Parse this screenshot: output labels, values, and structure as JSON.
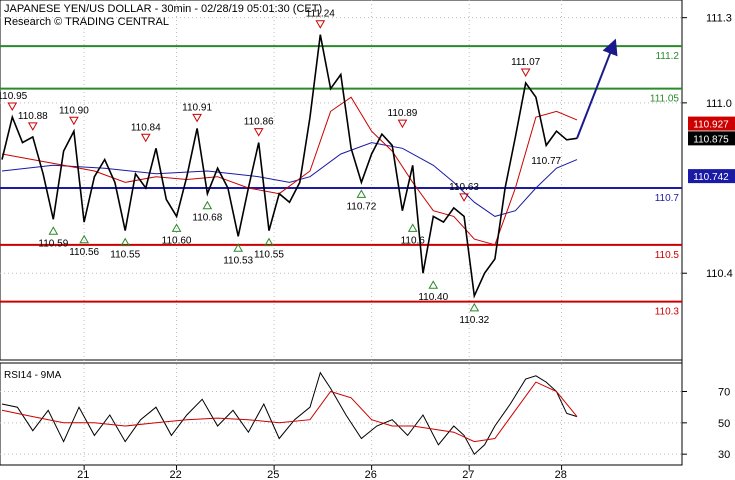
{
  "header": {
    "title": "JAPANESE YEN/US DOLLAR - 30min - 02/28/19 05:01:30 (CET)",
    "subtitle": "Research © TRADING CENTRAL"
  },
  "colors": {
    "price": "#000000",
    "ma_fast": "#cc0000",
    "ma_slow": "#1a1aa6",
    "resistance": "#2a8a2a",
    "support": "#cc0000",
    "pivot": "#1a1aa6",
    "up_marker": "#2a8a2a",
    "down_marker": "#cc0000",
    "arrow": "#1a1a8c"
  },
  "chart_data": [
    {
      "type": "line",
      "panel": "price",
      "x_ticks": [
        "21",
        "22",
        "25",
        "26",
        "27",
        "28"
      ],
      "y_ticks": [
        "111.3",
        "111.0",
        "110.4"
      ],
      "ylim": [
        110.2,
        111.32
      ],
      "series": [
        {
          "name": "price",
          "x": [
            0,
            2,
            4,
            6,
            8,
            10,
            12,
            14,
            16,
            18,
            20,
            22,
            24,
            26,
            28,
            30,
            32,
            34,
            36,
            38,
            40,
            42,
            44,
            46,
            48,
            50,
            52,
            54,
            56,
            58,
            60,
            62,
            64,
            66,
            68,
            70,
            72,
            74,
            76,
            78,
            80,
            82,
            84,
            86,
            88,
            90,
            92,
            94,
            96,
            98,
            100,
            102,
            104,
            106,
            108,
            110,
            112
          ],
          "values": [
            110.8,
            110.95,
            110.86,
            110.88,
            110.75,
            110.59,
            110.83,
            110.9,
            110.58,
            110.74,
            110.8,
            110.72,
            110.55,
            110.75,
            110.7,
            110.84,
            110.66,
            110.6,
            110.74,
            110.91,
            110.68,
            110.77,
            110.7,
            110.53,
            110.7,
            110.86,
            110.55,
            110.68,
            110.65,
            110.72,
            110.95,
            111.24,
            111.05,
            111.1,
            110.84,
            110.72,
            110.82,
            110.89,
            110.85,
            110.62,
            110.78,
            110.4,
            110.6,
            110.58,
            110.63,
            110.6,
            110.32,
            110.4,
            110.45,
            110.7,
            110.88,
            111.07,
            111.02,
            110.85,
            110.9,
            110.87,
            110.875
          ]
        },
        {
          "name": "fast_ma",
          "x": [
            0,
            6,
            12,
            18,
            24,
            30,
            36,
            42,
            48,
            54,
            60,
            64,
            68,
            72,
            76,
            80,
            84,
            88,
            92,
            96,
            100,
            104,
            108,
            112
          ],
          "values": [
            110.82,
            110.8,
            110.78,
            110.76,
            110.72,
            110.74,
            110.73,
            110.74,
            110.7,
            110.68,
            110.76,
            110.97,
            111.02,
            110.9,
            110.83,
            110.72,
            110.62,
            110.6,
            110.52,
            110.5,
            110.7,
            110.95,
            110.97,
            110.94
          ]
        },
        {
          "name": "slow_ma",
          "x": [
            0,
            10,
            20,
            30,
            40,
            50,
            56,
            60,
            66,
            72,
            78,
            84,
            88,
            92,
            96,
            100,
            104,
            108,
            112
          ],
          "values": [
            110.76,
            110.78,
            110.77,
            110.75,
            110.76,
            110.74,
            110.72,
            110.74,
            110.82,
            110.86,
            110.84,
            110.78,
            110.72,
            110.65,
            110.6,
            110.62,
            110.7,
            110.77,
            110.8
          ]
        }
      ],
      "forecast_arrow": {
        "x": [
          112,
          119
        ],
        "values": [
          110.875,
          111.2
        ]
      },
      "levels": [
        {
          "value": 111.2,
          "label": "111.2",
          "kind": "resistance"
        },
        {
          "value": 111.05,
          "label": "111.05",
          "kind": "resistance"
        },
        {
          "value": 110.7,
          "label": "110.7",
          "kind": "pivot"
        },
        {
          "value": 110.5,
          "label": "110.5",
          "kind": "support"
        },
        {
          "value": 110.3,
          "label": "110.3",
          "kind": "support"
        }
      ],
      "current_values": [
        {
          "value": 110.927,
          "label": "110.927",
          "bg": "#cc0000",
          "fg": "#ffffff"
        },
        {
          "value": 110.875,
          "label": "110.875",
          "bg": "#000000",
          "fg": "#ffffff"
        },
        {
          "value": 110.742,
          "label": "110.742",
          "bg": "#1a1aa6",
          "fg": "#ffffff"
        }
      ],
      "annotations": [
        {
          "x": 2,
          "value": 110.95,
          "text": "110.95",
          "dir": "down"
        },
        {
          "x": 6,
          "value": 110.88,
          "text": "110.88",
          "dir": "down"
        },
        {
          "x": 10,
          "value": 110.59,
          "text": "110.59",
          "dir": "up"
        },
        {
          "x": 14,
          "value": 110.9,
          "text": "110.90",
          "dir": "down"
        },
        {
          "x": 16,
          "value": 110.56,
          "text": "110.56",
          "dir": "up"
        },
        {
          "x": 24,
          "value": 110.55,
          "text": "110.55",
          "dir": "up"
        },
        {
          "x": 28,
          "value": 110.84,
          "text": "110.84",
          "dir": "down"
        },
        {
          "x": 34,
          "value": 110.6,
          "text": "110.60",
          "dir": "up"
        },
        {
          "x": 38,
          "value": 110.91,
          "text": "110.91",
          "dir": "down"
        },
        {
          "x": 40,
          "value": 110.68,
          "text": "110.68",
          "dir": "up"
        },
        {
          "x": 46,
          "value": 110.53,
          "text": "110.53",
          "dir": "up"
        },
        {
          "x": 50,
          "value": 110.86,
          "text": "110.86",
          "dir": "down"
        },
        {
          "x": 52,
          "value": 110.55,
          "text": "110.55",
          "dir": "up"
        },
        {
          "x": 62,
          "value": 111.24,
          "text": "111.24",
          "dir": "down"
        },
        {
          "x": 70,
          "value": 110.72,
          "text": "110.72",
          "dir": "up"
        },
        {
          "x": 78,
          "value": 110.89,
          "text": "110.89",
          "dir": "down"
        },
        {
          "x": 80,
          "value": 110.6,
          "text": "110.6",
          "dir": "up"
        },
        {
          "x": 84,
          "value": 110.4,
          "text": "110.40",
          "dir": "up"
        },
        {
          "x": 90,
          "value": 110.63,
          "text": "110.63",
          "dir": "down"
        },
        {
          "x": 92,
          "value": 110.32,
          "text": "110.32",
          "dir": "up"
        },
        {
          "x": 102,
          "value": 111.07,
          "text": "111.07",
          "dir": "down"
        },
        {
          "x": 106,
          "value": 110.77,
          "text": "110.77",
          "dir": "none"
        }
      ]
    },
    {
      "type": "line",
      "panel": "rsi",
      "title": "RSI14 - 9MA",
      "y_ticks": [
        "70",
        "50",
        "30"
      ],
      "ylim": [
        25,
        85
      ],
      "series": [
        {
          "name": "rsi14",
          "x": [
            0,
            3,
            6,
            9,
            12,
            15,
            18,
            21,
            24,
            27,
            30,
            33,
            36,
            39,
            42,
            45,
            48,
            51,
            54,
            57,
            60,
            62,
            64,
            67,
            70,
            73,
            76,
            79,
            82,
            85,
            88,
            90,
            92,
            94,
            96,
            99,
            102,
            104,
            106,
            108,
            110,
            112
          ],
          "values": [
            62,
            60,
            45,
            58,
            38,
            60,
            42,
            55,
            38,
            52,
            60,
            42,
            55,
            65,
            48,
            58,
            44,
            62,
            40,
            52,
            60,
            82,
            72,
            55,
            40,
            48,
            52,
            42,
            55,
            36,
            48,
            42,
            30,
            36,
            48,
            62,
            78,
            80,
            76,
            70,
            56,
            54
          ]
        },
        {
          "name": "rsi_ma9",
          "x": [
            0,
            6,
            12,
            18,
            24,
            30,
            36,
            42,
            48,
            54,
            60,
            64,
            68,
            72,
            76,
            80,
            84,
            88,
            92,
            96,
            100,
            104,
            108,
            112
          ],
          "values": [
            58,
            54,
            50,
            50,
            48,
            50,
            52,
            53,
            52,
            50,
            52,
            70,
            66,
            52,
            48,
            48,
            46,
            44,
            38,
            40,
            58,
            76,
            70,
            54
          ]
        }
      ]
    }
  ]
}
